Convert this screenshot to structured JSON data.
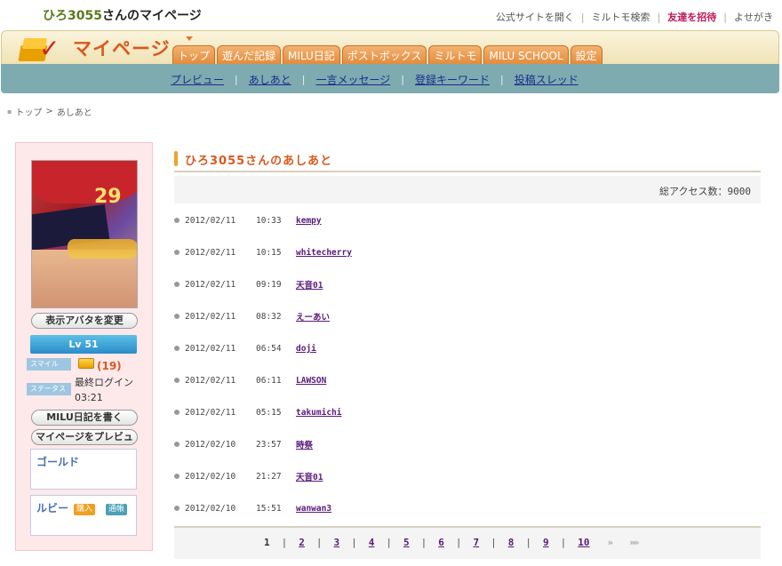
{
  "topbar": {
    "username": "ひろ3055",
    "title_suffix": "さんのマイページ",
    "links": [
      "公式サイトを開く",
      "ミルトモ検索",
      "友達を招待",
      "よせがき"
    ]
  },
  "header": {
    "logo_text": "マイページ",
    "tabs": [
      "トップ",
      "遊んだ記録",
      "MILU日記",
      "ポストボックス",
      "ミルトモ",
      "MILU SCHOOL",
      "設定"
    ]
  },
  "subnav": {
    "items": [
      "プレビュー",
      "あしあと",
      "一言メッセージ",
      "登録キーワード",
      "投稿スレッド"
    ]
  },
  "breadcrumb": {
    "items": [
      "トップ",
      "あしあと"
    ]
  },
  "sidebar": {
    "change_avatar": "表示アバタを変更",
    "level": "Lv 51",
    "smile_label": "スマイル",
    "smile_count": "(19)",
    "status_label": "ステータス",
    "last_login_label": "最終ログイン",
    "last_login_time": "03:21",
    "write_diary": "MILU日記を書く",
    "preview_mypage": "マイページをプレビュー",
    "gold_label": "ゴールド",
    "ruby_label": "ルビー",
    "buy_label": "購入",
    "passbook_label": "通帳",
    "colors": {
      "accent": "#d9581e",
      "panel": "#fde8ea",
      "level": "#2a8cc8"
    }
  },
  "main": {
    "title": "ひろ3055さんのあしあと",
    "total_access": "総アクセス数：9000",
    "visits": [
      {
        "date": "2012/02/11",
        "time": "10:33",
        "name": "kempy"
      },
      {
        "date": "2012/02/11",
        "time": "10:15",
        "name": "whitecherry"
      },
      {
        "date": "2012/02/11",
        "time": "09:19",
        "name": "天音01"
      },
      {
        "date": "2012/02/11",
        "time": "08:32",
        "name": "えーあい"
      },
      {
        "date": "2012/02/11",
        "time": "06:54",
        "name": "doji"
      },
      {
        "date": "2012/02/11",
        "time": "06:11",
        "name": "LAWSON"
      },
      {
        "date": "2012/02/11",
        "time": "05:15",
        "name": "takumichi"
      },
      {
        "date": "2012/02/10",
        "time": "23:57",
        "name": "時祭"
      },
      {
        "date": "2012/02/10",
        "time": "21:27",
        "name": "天音01"
      },
      {
        "date": "2012/02/10",
        "time": "15:51",
        "name": "wanwan3"
      }
    ],
    "pagination": {
      "current": "1",
      "pages": [
        "2",
        "3",
        "4",
        "5",
        "6",
        "7",
        "8",
        "9",
        "10"
      ],
      "next": "»",
      "last": "»»"
    }
  }
}
